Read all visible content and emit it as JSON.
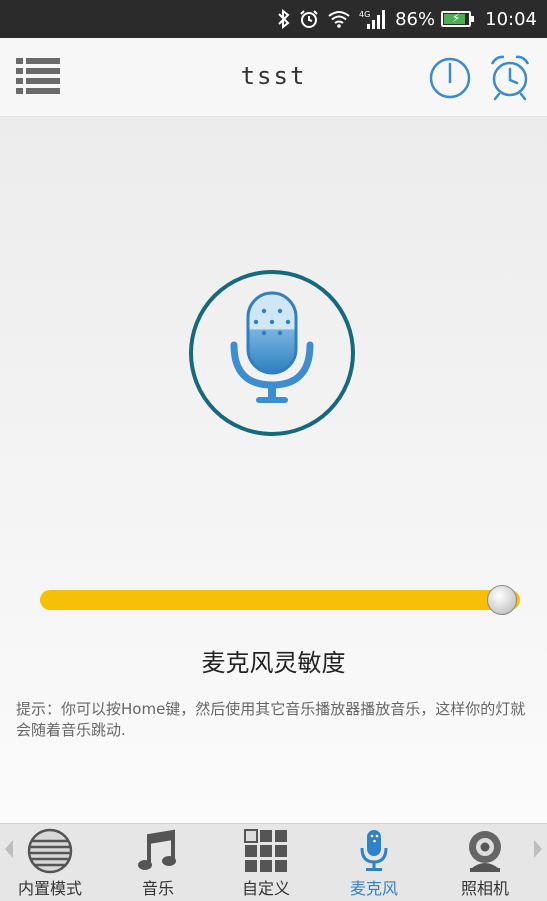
{
  "status_bar": {
    "battery": "86%",
    "time": "10:04",
    "network": "4G"
  },
  "header": {
    "title": "tsst",
    "icons": [
      "list-menu-icon",
      "power-icon",
      "alarm-clock-icon"
    ]
  },
  "main": {
    "mic_icon": "microphone-icon",
    "sensitivity_value": 0.97,
    "sensitivity_label": "麦克风灵敏度",
    "hint": "提示：你可以按Home键，然后使用其它音乐播放器播放音乐，这样你的灯就会随着音乐跳动."
  },
  "bottom_nav": {
    "active": "mic",
    "items": [
      {
        "label": "内置模式",
        "icon": "builtin-mode-icon"
      },
      {
        "label": "音乐",
        "icon": "music-note-icon"
      },
      {
        "label": "自定义",
        "icon": "grid-icon"
      },
      {
        "label": "麦克风",
        "icon": "microphone-icon"
      },
      {
        "label": "照相机",
        "icon": "webcam-icon"
      }
    ]
  },
  "colors": {
    "accent": "#2f82c8",
    "slider": "#f5c007",
    "mic_ring": "#176a7c"
  }
}
